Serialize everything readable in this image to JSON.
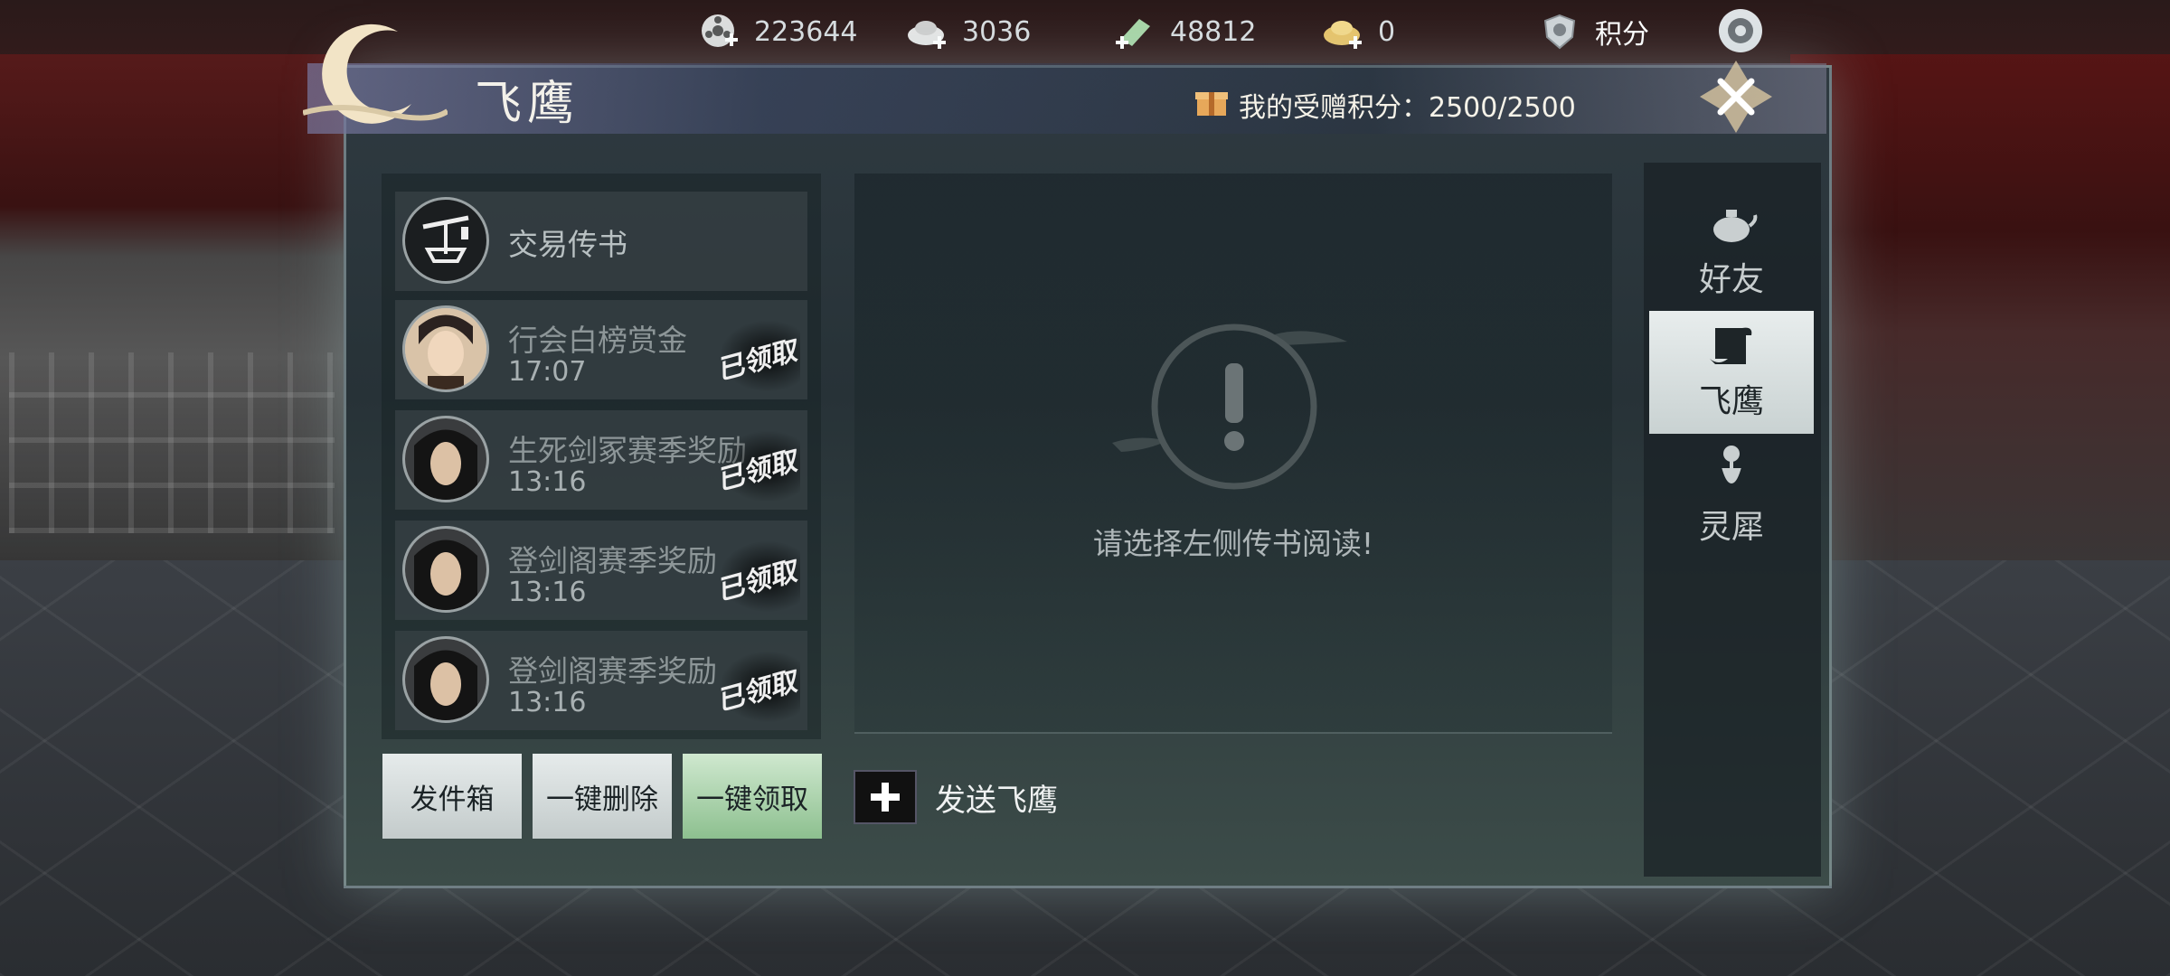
{
  "resources": [
    {
      "icon": "film-reel-plus-icon",
      "value": "223644"
    },
    {
      "icon": "silver-ingot-plus-icon",
      "value": "3036"
    },
    {
      "icon": "jade-plus-icon",
      "value": "48812"
    },
    {
      "icon": "gold-ingot-plus-icon",
      "value": "0"
    }
  ],
  "points": {
    "icon": "shield-badge-icon",
    "label": "积分"
  },
  "header": {
    "title": "飞鹰",
    "gift_points_label": "我的受赠积分：2500/2500"
  },
  "mail_list": [
    {
      "title": "交易传书",
      "time": "",
      "claimed": "",
      "avatar": "scale-icon"
    },
    {
      "title": "行会白榜赏金",
      "time": "17:07",
      "claimed": "已领取",
      "avatar": "avatar-male-1"
    },
    {
      "title": "生死剑冢赛季奖励",
      "time": "13:16",
      "claimed": "已领取",
      "avatar": "avatar-male-2"
    },
    {
      "title": "登剑阁赛季奖励",
      "time": "13:16",
      "claimed": "已领取",
      "avatar": "avatar-male-2"
    },
    {
      "title": "登剑阁赛季奖励",
      "time": "13:16",
      "claimed": "已领取",
      "avatar": "avatar-male-2"
    }
  ],
  "buttons": {
    "outbox": "发件箱",
    "delete_all": "一键删除",
    "claim_all": "一键领取"
  },
  "reader": {
    "empty_text": "请选择左侧传书阅读!",
    "send_label": "发送飞鹰"
  },
  "tabs": [
    {
      "label": "好友",
      "icon": "teapot-icon",
      "active": false
    },
    {
      "label": "飞鹰",
      "icon": "scroll-icon",
      "active": true
    },
    {
      "label": "灵犀",
      "icon": "flower-vase-icon",
      "active": false
    }
  ]
}
